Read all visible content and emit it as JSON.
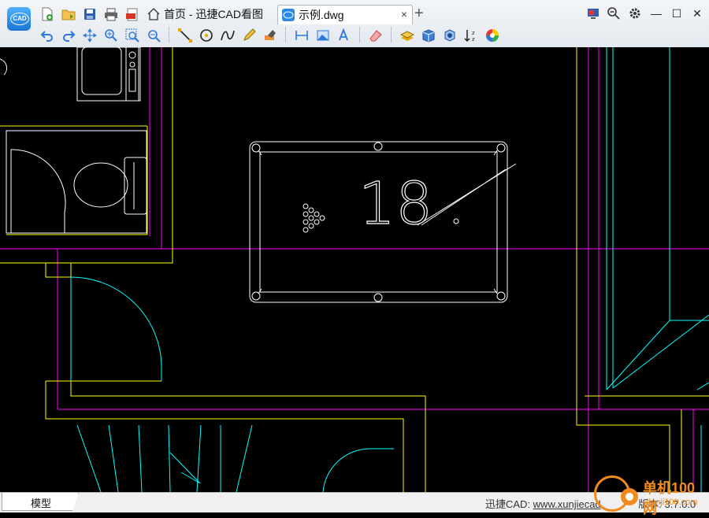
{
  "app": {
    "logo_text": "CAD",
    "tabs": [
      {
        "label": "首页 - 迅捷CAD看图",
        "icon": "home-icon"
      },
      {
        "label": "示例.dwg",
        "icon": "cad-file-icon",
        "close": "×"
      }
    ],
    "add_tab": "+",
    "window_controls": {
      "minimize": "—",
      "maximize": "☐",
      "close": "✕"
    }
  },
  "toolbar_top": [
    "new-file-icon",
    "open-file-icon",
    "save-icon",
    "print-icon",
    "export-pdf-icon"
  ],
  "toolbar_bottom": [
    "undo-icon",
    "redo-icon",
    "pan-icon",
    "zoom-realtime-icon",
    "zoom-window-icon",
    "zoom-extent-icon",
    "line-icon",
    "circle-icon",
    "spline-icon",
    "pencil-icon",
    "eraser-markup-icon",
    "measure-icon",
    "area-icon",
    "text-icon",
    "erase-icon",
    "layers-icon",
    "3d-view-icon",
    "3d-orbit-icon",
    "sort-icon",
    "color-wheel-icon"
  ],
  "drawing": {
    "table_number": "18",
    "colors": {
      "yellow": "#ffff00",
      "magenta": "#ff00ff",
      "cyan": "#00ffff",
      "white": "#ffffff",
      "background": "#000000"
    }
  },
  "status": {
    "model_tab": "模型",
    "brand_text": "迅捷CAD: ",
    "url": "www.xunjiecad",
    "version_text": "版本: 3.7.0.0"
  },
  "watermark": {
    "title": "单机100网",
    "subtitle": "danji100.com"
  }
}
